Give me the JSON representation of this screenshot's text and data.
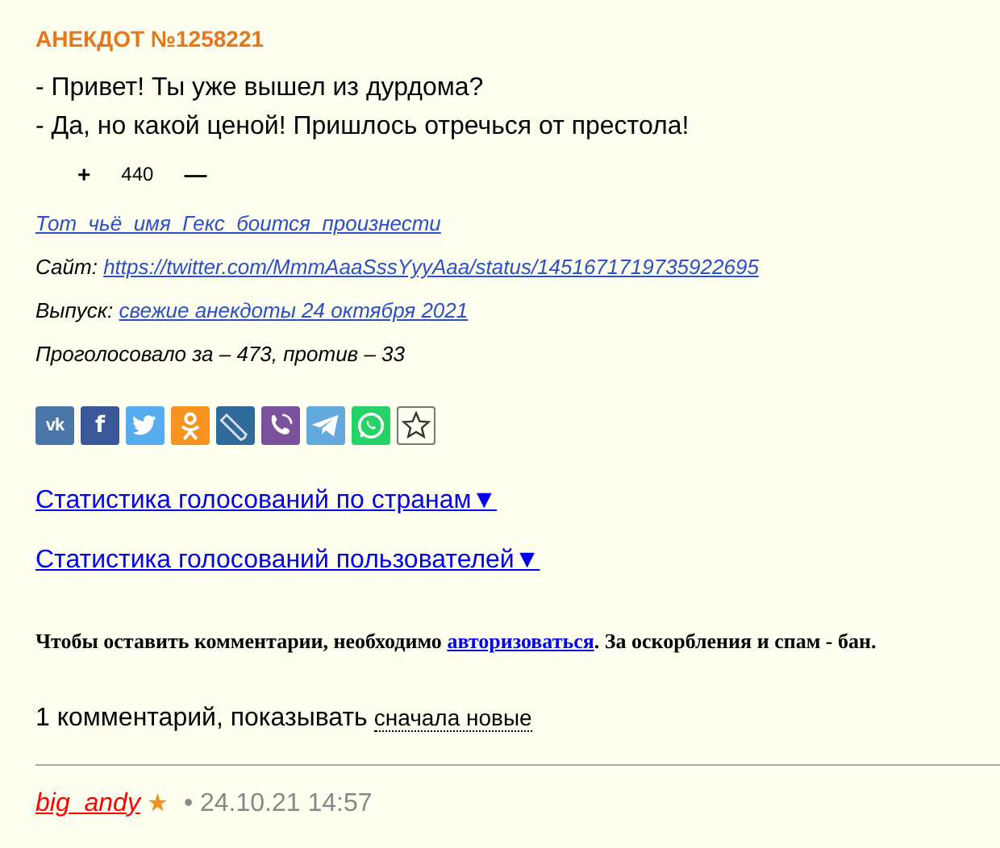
{
  "joke": {
    "title": "АНЕКДОТ №1258221",
    "lines": [
      "- Привет! Ты уже вышел из дурдома?",
      "- Да, но какой ценой! Пришлось отречься от престола!"
    ],
    "vote": {
      "plus": "+",
      "score": "440",
      "minus": "—"
    },
    "author": "Тот_чьё_имя_Гекс_боится_произнести",
    "site_label": "Сайт:",
    "site_link": "https://twitter.com/MmmAaaSssYyyAaa/status/1451671719735922695",
    "issue_label": "Выпуск:",
    "issue_link": "свежие анекдоты 24 октября 2021",
    "votes_text": "Проголосовало за – 473, против – 33"
  },
  "share_buttons": [
    {
      "kind": "vk",
      "glyph": "vk"
    },
    {
      "kind": "facebook",
      "glyph": "f"
    },
    {
      "kind": "twitter"
    },
    {
      "kind": "ok"
    },
    {
      "kind": "livejournal"
    },
    {
      "kind": "viber"
    },
    {
      "kind": "telegram"
    },
    {
      "kind": "whatsapp"
    },
    {
      "kind": "favorite"
    }
  ],
  "stats_links": [
    "Статистика голосований по странам▼",
    "Статистика голосований пользователей▼"
  ],
  "comment_notice": {
    "before": "Чтобы оставить комментарии, необходимо ",
    "link": "авторизоваться",
    "after": ". За оскорбления и спам - бан."
  },
  "comments_header": {
    "count": "1 комментарий, показывать",
    "sort": "сначала новые"
  },
  "comments": [
    {
      "user": "big_andy",
      "star": "★",
      "meta": "• 24.10.21 14:57"
    }
  ]
}
